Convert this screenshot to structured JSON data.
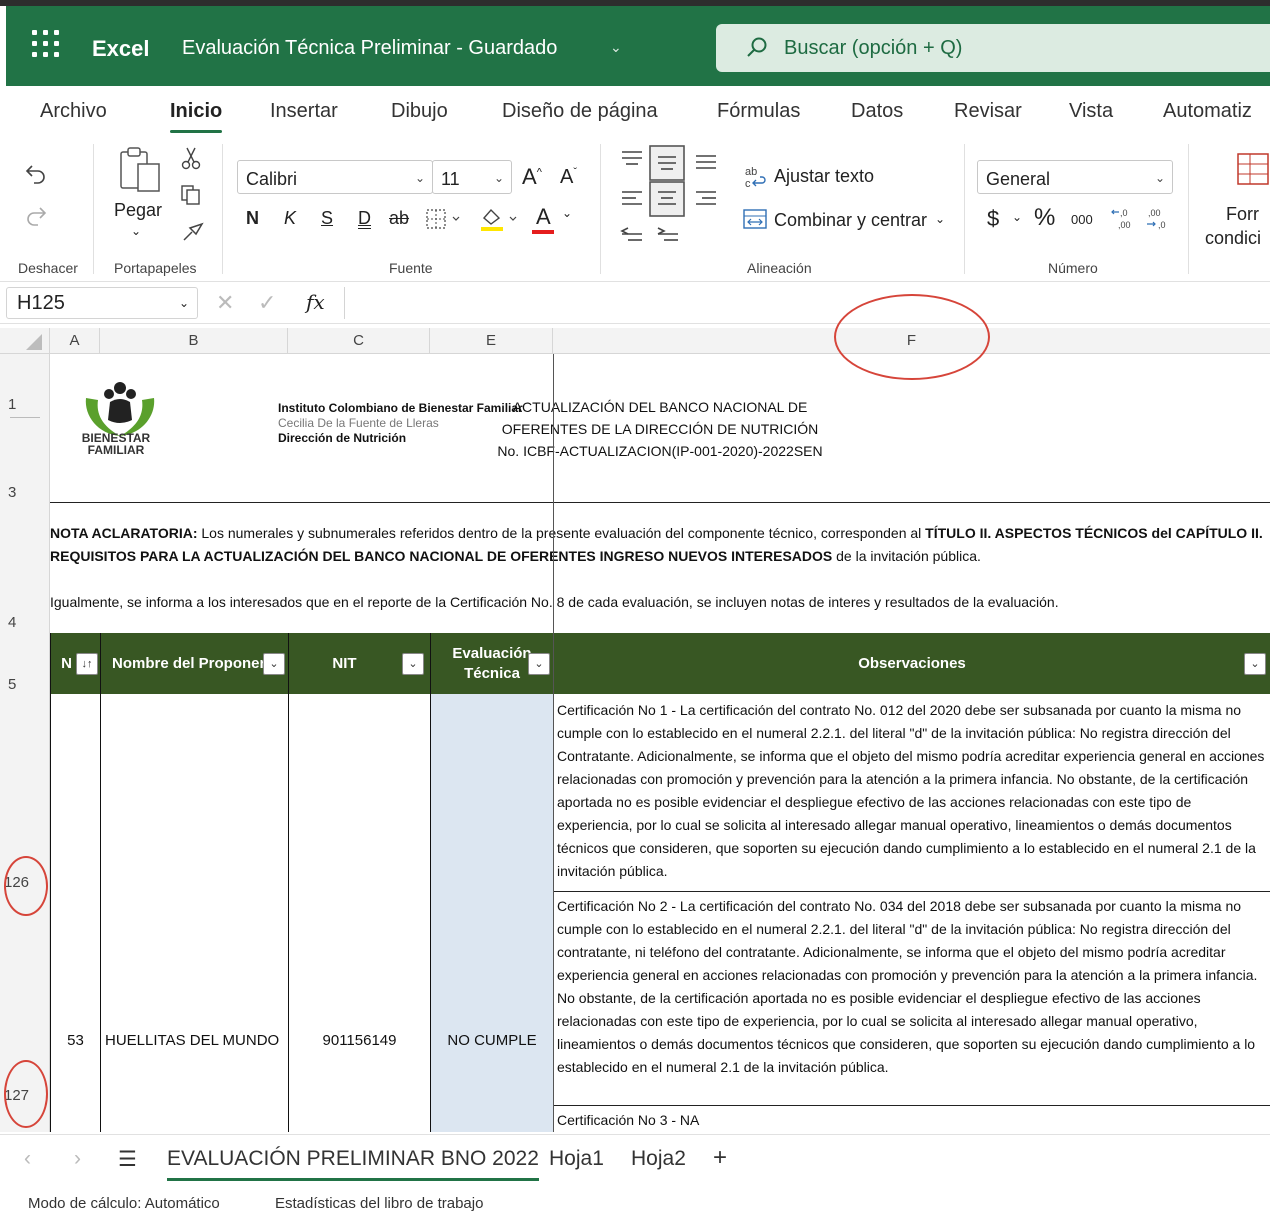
{
  "titlebar": {
    "app_name": "Excel",
    "doc_title": "Evaluación Técnica Preliminar - Guardado",
    "search_placeholder": "Buscar (opción + Q)"
  },
  "ribbon_tabs": [
    "Archivo",
    "Inicio",
    "Insertar",
    "Dibujo",
    "Diseño de página",
    "Fórmulas",
    "Datos",
    "Revisar",
    "Vista",
    "Automatiz"
  ],
  "ribbon": {
    "undo_group": "Deshacer",
    "clipboard_group": "Portapapeles",
    "paste_label": "Pegar",
    "font_group": "Fuente",
    "font_name": "Calibri",
    "font_size": "11",
    "bold": "N",
    "italic": "K",
    "underline": "S",
    "double_underline": "D",
    "strike": "ab",
    "font_color_letter": "A",
    "alignment_group": "Alineación",
    "wrap_text": "Ajustar texto",
    "merge_center": "Combinar y centrar",
    "number_group": "Número",
    "number_format": "General",
    "currency": "$",
    "percent": "%",
    "thousands": "000",
    "cond_format_1": "Forr",
    "cond_format_2": "condici"
  },
  "formula_bar": {
    "name_box": "H125",
    "fx": "fx",
    "formula": ""
  },
  "columns": [
    "A",
    "B",
    "C",
    "E",
    "F"
  ],
  "rows": {
    "r1": "1",
    "r3": "3",
    "r4": "4",
    "r5": "5",
    "r126": "126",
    "r127": "127"
  },
  "header_block": {
    "inst_line1": "Instituto Colombiano de Bienestar Familiar",
    "inst_line2": "Cecilia De la Fuente de Lleras",
    "inst_line3": "Dirección de Nutrición",
    "logo_line1": "BIENESTAR",
    "logo_line2": "FAMILIAR",
    "title_line1": "ACTUALIZACIÓN DEL BANCO NACIONAL DE",
    "title_line2": "OFERENTES DE LA DIRECCIÓN DE NUTRICIÓN",
    "title_line3": "No. ICBF-ACTUALIZACION(IP-001-2020)-2022SEN"
  },
  "nota": {
    "label": "NOTA ACLARATORIA:",
    "text1": " Los numerales y subnumerales referidos dentro de la presente evaluación del componente técnico, corresponden al  ",
    "bold1": "TÍTULO II. ASPECTOS TÉCNICOS del CAPÍTULO II. REQUISITOS PARA LA ACTUALIZACIÓN DEL BANCO NACIONAL DE OFERENTES INGRESO NUEVOS INTERESADOS",
    "text2": " de la invitación pública.",
    "line2": "Igualmente, se informa a los interesados que en el reporte de la Certificación No. 8 de cada evaluación, se incluyen notas de interes y resultados de la evaluación."
  },
  "table_headers": {
    "no": "N",
    "proponente": "Nombre del Proponer",
    "nit": "NIT",
    "evaluacion_1": "Evaluación",
    "evaluacion_2": "Técnica",
    "observaciones": "Observaciones"
  },
  "record": {
    "no": "53",
    "name": "HUELLITAS DEL MUNDO",
    "nit": "901156149",
    "evaluation": "NO CUMPLE",
    "observations": [
      "Certificación No 1 - La certificación del contrato No. 012 del 2020 debe ser subsanada por cuanto la misma no cumple con lo establecido en el numeral 2.2.1. del literal \"d\" de la invitación pública: No registra dirección del Contratante. Adicionalmente, se informa que el objeto del mismo podría acreditar experiencia general en acciones relacionadas con promoción y prevención para la atención a la primera infancia. No obstante, de la certificación aportada no es posible evidenciar el despliegue efectivo de las acciones relacionadas con este tipo de experiencia, por lo cual se solicita al interesado allegar manual operativo, lineamientos o demás documentos técnicos que consideren, que soporten su ejecución dando cumplimiento a lo establecido en el numeral 2.1 de la invitación pública.",
      "Certificación No 2 - La certificación del contrato No. 034  del 2018 debe ser subsanada por cuanto la misma no cumple con lo establecido en el numeral 2.2.1. del literal \"d\" de la invitación pública: No registra dirección del contratante, ni teléfono del contratante. Adicionalmente, se informa que el objeto del mismo podría acreditar experiencia general en acciones relacionadas con promoción y prevención para la atención a la primera infancia. No obstante, de la certificación aportada no es posible evidenciar el despliegue efectivo de las acciones relacionadas con este tipo de experiencia, por lo cual se solicita al interesado allegar manual operativo, lineamientos o demás documentos técnicos que consideren, que soporten su ejecución dando cumplimiento a lo establecido en el numeral 2.1 de la invitación pública.",
      "Certificación No 3 - NA"
    ]
  },
  "sheet_tabs": [
    "EVALUACIÓN PRELIMINAR BNO 2022",
    "Hoja1",
    "Hoja2"
  ],
  "status_bar": {
    "calc_mode": "Modo de cálculo: Automático",
    "stats": "Estadísticas del libro de trabajo"
  },
  "colors": {
    "excel_green": "#217346",
    "table_header": "#385723",
    "eval_cell": "#dce6f1",
    "annotation_red": "#d6453a"
  }
}
